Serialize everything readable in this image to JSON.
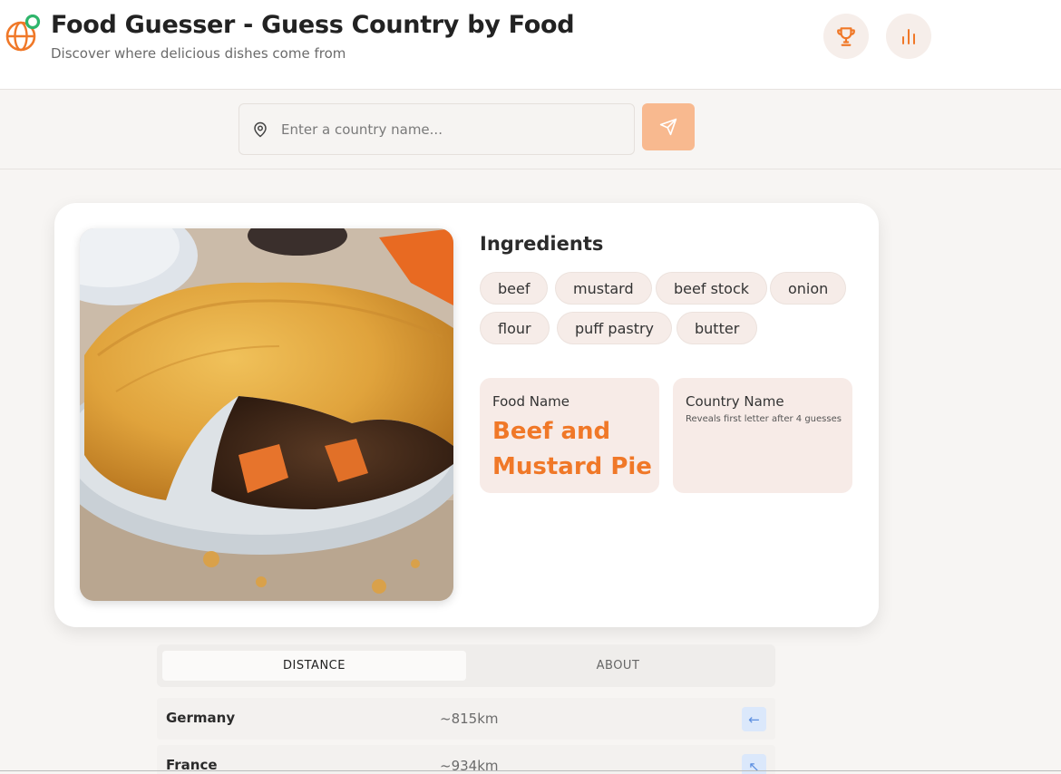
{
  "header": {
    "title": "Food Guesser - Guess Country by Food",
    "subtitle": "Discover where delicious dishes come from",
    "icons": {
      "logo": "globe-pin-icon",
      "leaderboard": "trophy-icon",
      "stats": "bar-chart-icon"
    }
  },
  "search": {
    "placeholder": "Enter a country name...",
    "value": "",
    "icon": "map-pin-icon",
    "submit_icon": "send-icon"
  },
  "card": {
    "image_alt": "Beef and Mustard Pie",
    "ingredients_title": "Ingredients",
    "ingredients": [
      "beef",
      "mustard",
      "beef stock",
      "onion",
      "flour",
      "puff pastry",
      "butter"
    ],
    "food_label": "Food Name",
    "food_value": "Beef and Mustard Pie",
    "country_label": "Country Name",
    "country_hint": "Reveals first letter after 4 guesses"
  },
  "tabs": [
    {
      "label": "DISTANCE",
      "active": true
    },
    {
      "label": "ABOUT",
      "active": false
    }
  ],
  "guesses": [
    {
      "country": "Germany",
      "distance": "~815km",
      "direction": "←"
    },
    {
      "country": "France",
      "distance": "~934km",
      "direction": "↖"
    }
  ],
  "colors": {
    "accent": "#f07828",
    "send_button": "#f8b98f",
    "chip_bg": "#f6ece8",
    "info_bg": "#f7ebe7",
    "direction_bg": "#dbe8fb"
  }
}
